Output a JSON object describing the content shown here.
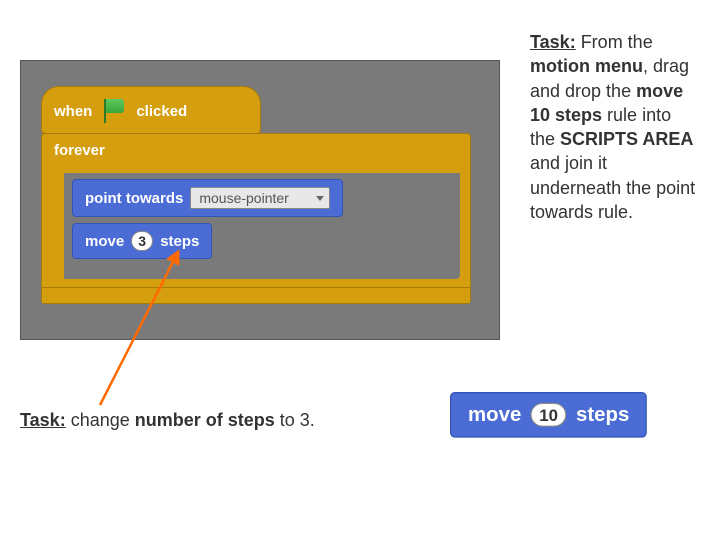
{
  "scratch": {
    "hat": {
      "when": "when",
      "flag": "green-flag",
      "clicked": "clicked"
    },
    "forever": "forever",
    "point_towards": {
      "label": "point towards",
      "value": "mouse-pointer"
    },
    "move": {
      "label_pre": "move",
      "value": "3",
      "label_post": "steps"
    }
  },
  "task_right": {
    "prefix": "Task:",
    "t1": " From the ",
    "b1": "motion menu",
    "t2": ", drag and drop the ",
    "b2": "move 10 steps",
    "t3": " rule into the ",
    "b3": "SCRIPTS AREA",
    "t4": " and join it underneath the point towards rule."
  },
  "task_bottom": {
    "prefix": "Task:",
    "t1": " change ",
    "b1": "number of steps",
    "t2": " to 3."
  },
  "example": {
    "label_pre": "move",
    "value": "10",
    "label_post": "steps"
  }
}
